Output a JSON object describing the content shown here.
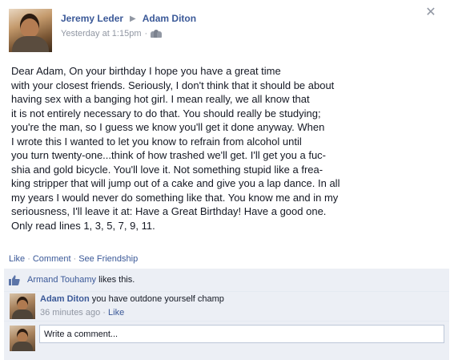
{
  "post": {
    "author": "Jeremy Leder",
    "recipient": "Adam Diton",
    "timestamp": "Yesterday at 1:15pm",
    "separator": "·",
    "audience_icon": "friends-icon",
    "close_icon": "close-icon",
    "message_lines": [
      "Dear Adam, On your birthday I hope you have a great time",
      "with your closest friends. Seriously, I don't think that it should be about",
      "having sex with a banging hot girl. I mean really, we all know that",
      "it is not entirely necessary to do that. You should really be studying;",
      "you're the man, so I guess we know you'll get it done anyway. When",
      "I wrote this I wanted to let you know to refrain from alcohol until",
      "you turn twenty-one...think of how trashed we'll get. I'll get you a fuc-",
      "shia and gold bicycle. You'll love it. Not something stupid like a frea-",
      "king stripper that will jump out of a cake and give you a lap dance. In all",
      "my years I would never do something like that. You know me and in my",
      "seriousness, I'll leave it at: Have a Great Birthday! Have a good one.",
      "Only read lines 1, 3, 5, 7, 9, 11."
    ]
  },
  "actions": {
    "like": "Like",
    "comment": "Comment",
    "see_friendship": "See Friendship",
    "separator": "·"
  },
  "likes": {
    "name": "Armand Touhamy",
    "suffix": " likes this."
  },
  "comment": {
    "author": "Adam Diton",
    "text": "you have outdone yourself champ",
    "time": "36 minutes ago",
    "separator": "·",
    "like": "Like"
  },
  "composer": {
    "placeholder": "Write a comment..."
  },
  "colors": {
    "link": "#3b5998",
    "meta": "#9197a3",
    "feedback_bg": "#eceff5"
  }
}
